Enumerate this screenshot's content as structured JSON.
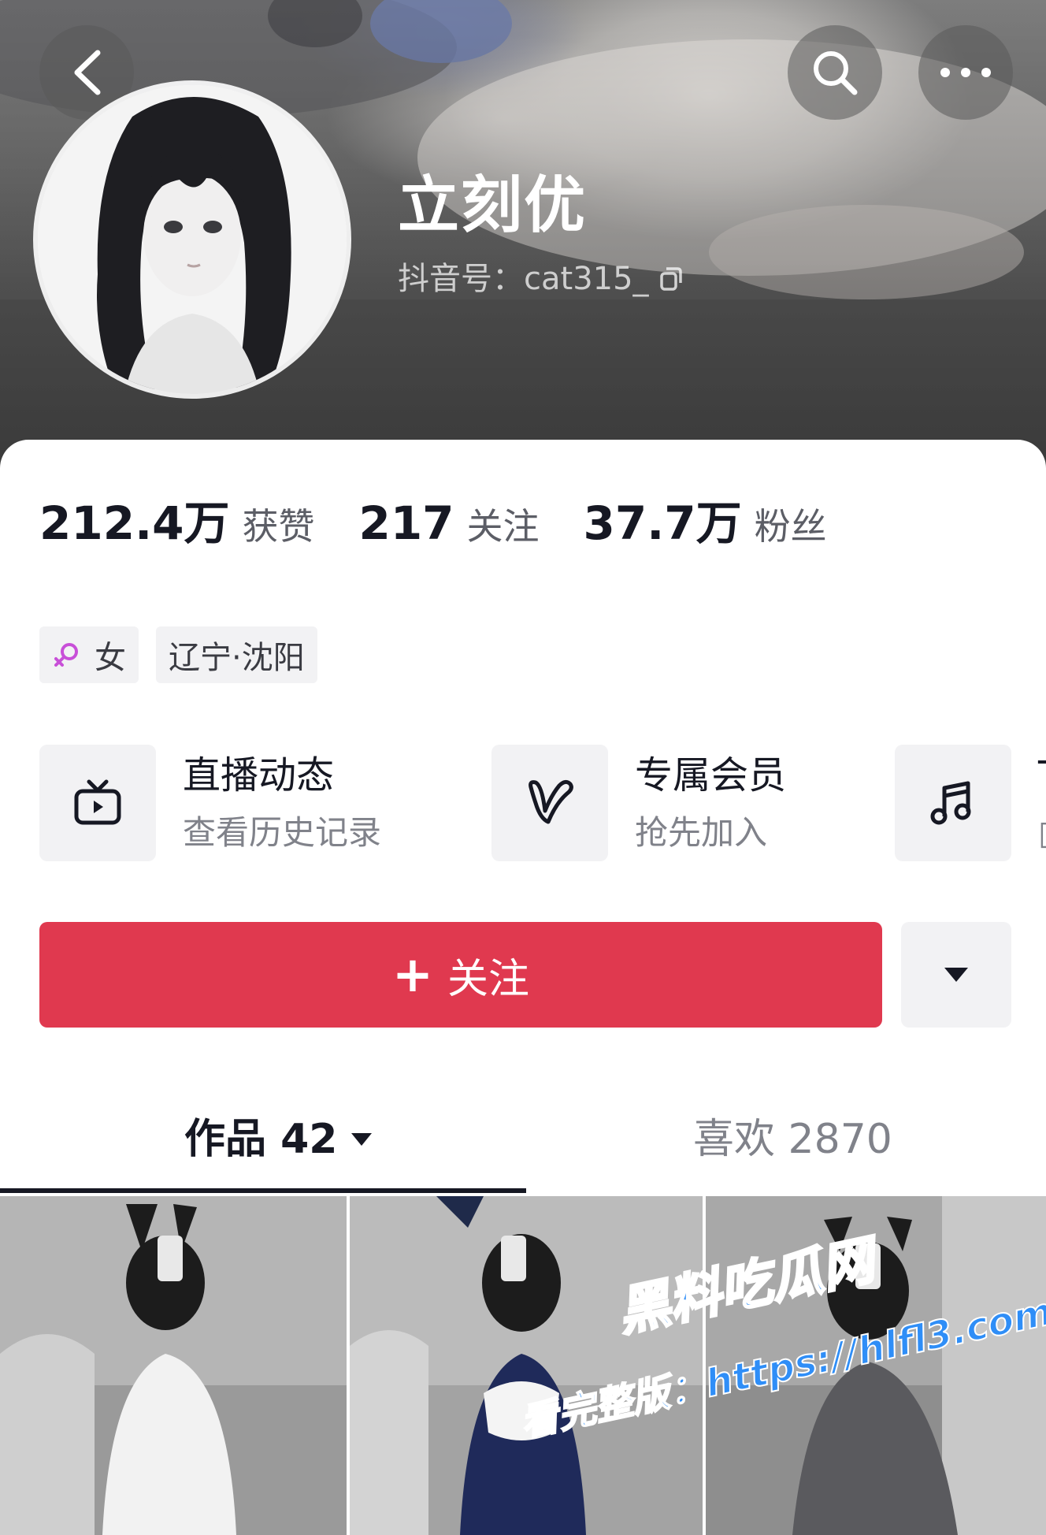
{
  "profile": {
    "nickname": "立刻优",
    "douyin_id_label": "抖音号：",
    "douyin_id": "cat315_"
  },
  "stats": [
    {
      "value": "212.4万",
      "label": "获赞"
    },
    {
      "value": "217",
      "label": "关注"
    },
    {
      "value": "37.7万",
      "label": "粉丝"
    }
  ],
  "tags": {
    "gender": "女",
    "gender_icon": "female-icon",
    "location": "辽宁·沈阳"
  },
  "features": [
    {
      "icon": "tv-icon",
      "title": "直播动态",
      "subtitle": "查看历史记录"
    },
    {
      "icon": "heart-v-icon",
      "title": "专属会员",
      "subtitle": "抢先加入"
    },
    {
      "icon": "music-note-icon",
      "title": "T",
      "subtitle": "□"
    }
  ],
  "actions": {
    "follow_label": "关注",
    "follow_plus": "+"
  },
  "tabs": {
    "works": "作品 42",
    "likes": "喜欢 2870"
  },
  "watermark": {
    "brand": "黑料吃瓜网",
    "line": "看完整版：https://hlfl3.com"
  },
  "colors": {
    "accent": "#e0394f",
    "watermark": "#2f8ef7"
  }
}
